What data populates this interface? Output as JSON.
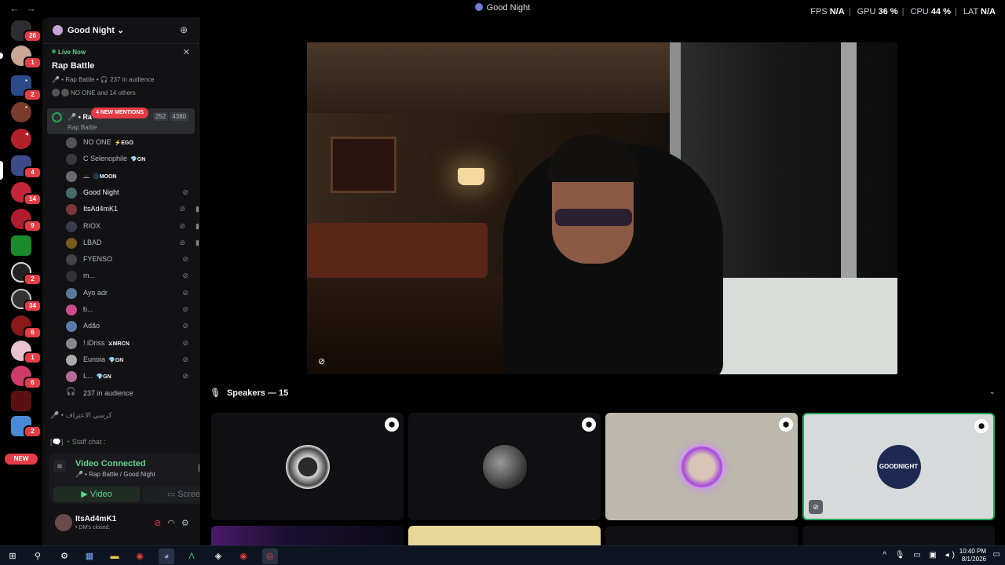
{
  "window": {
    "title": "Good Night",
    "nav_back": "←",
    "nav_forward": "→"
  },
  "stats": {
    "fps_label": "FPS",
    "fps_value": "N/A",
    "gpu_label": "GPU",
    "gpu_value": "36 %",
    "cpu_label": "CPU",
    "cpu_value": "44 %",
    "lat_label": "LAT",
    "lat_value": "N/A",
    "sep": "|"
  },
  "rail": {
    "home_badge": "26",
    "new_label": "NEW",
    "badges": [
      "1",
      "2",
      "4",
      "2",
      "34",
      "14",
      "9",
      "2",
      "6",
      "1",
      "6"
    ]
  },
  "server": {
    "name": "Good Night",
    "caret": "⌄"
  },
  "live": {
    "label": "Live Now",
    "title": "Rap Battle",
    "meta": "🎤 • Rap Battle • 🎧 237 in audience",
    "others": "NO ONE and 14 others",
    "close": "✕"
  },
  "stage_channel": {
    "name": "🎤 • Ra",
    "sub": "Rap Battle",
    "count_a": "252",
    "count_b": "4380",
    "mentions": "4 NEW MENTIONS"
  },
  "members": [
    {
      "name": "NO ONE",
      "tag": "⚡EGO",
      "mute": "",
      "cam": ""
    },
    {
      "name": "C Selenophile",
      "tag": "💎GN",
      "mute": "",
      "cam": ""
    },
    {
      "name": "ـنـ",
      "tag": "🌑MOON",
      "mute": "",
      "cam": ""
    },
    {
      "name": "Good Night",
      "tag": "",
      "mute": "⊘",
      "cam": ""
    },
    {
      "name": "ItsAd4mK1",
      "tag": "",
      "mute": "⊘",
      "cam": "▮"
    },
    {
      "name": "RIOX",
      "tag": "",
      "mute": "⊘",
      "cam": "▮"
    },
    {
      "name": "LBAD",
      "tag": "",
      "mute": "⊘",
      "cam": "▮"
    },
    {
      "name": "FYENSO",
      "tag": "",
      "mute": "⊘",
      "cam": ""
    },
    {
      "name": "m...",
      "tag": "",
      "mute": "⊘",
      "cam": ""
    },
    {
      "name": "Ayo adr",
      "tag": "",
      "mute": "⊘",
      "cam": ""
    },
    {
      "name": "b...",
      "tag": "",
      "mute": "⊘",
      "cam": ""
    },
    {
      "name": "Adão",
      "tag": "",
      "mute": "⊘",
      "cam": ""
    },
    {
      "name": "! iDriss",
      "tag": "⚔MRCN",
      "mute": "⊘",
      "cam": ""
    },
    {
      "name": "Eunoia",
      "tag": "💎GN",
      "mute": "⊘",
      "cam": ""
    },
    {
      "name": "L...",
      "tag": "💎GN",
      "mute": "⊘",
      "cam": ""
    }
  ],
  "audience": "237 in audience",
  "other_channels": {
    "chair": "🎤 • كرسي الاعتراف",
    "staff": "[🗨️] ・Staff chat :"
  },
  "rtc": {
    "status": "Video Connected",
    "location": "🎤 • Rap Battle / Good Night",
    "video_label": "Video",
    "screen_label": "Screen"
  },
  "user": {
    "name": "ItsAd4mK1",
    "status": "• DM's closed."
  },
  "speakers": {
    "header": "Speakers — 15",
    "tile4_text": "GOODNIGHT"
  },
  "taskbar": {
    "time": "10:40 PM",
    "date": "8/1/2026"
  },
  "colors": {
    "accent_green": "#23a55a",
    "badge_red": "#e53d45",
    "sidebar_bg": "#121214"
  }
}
